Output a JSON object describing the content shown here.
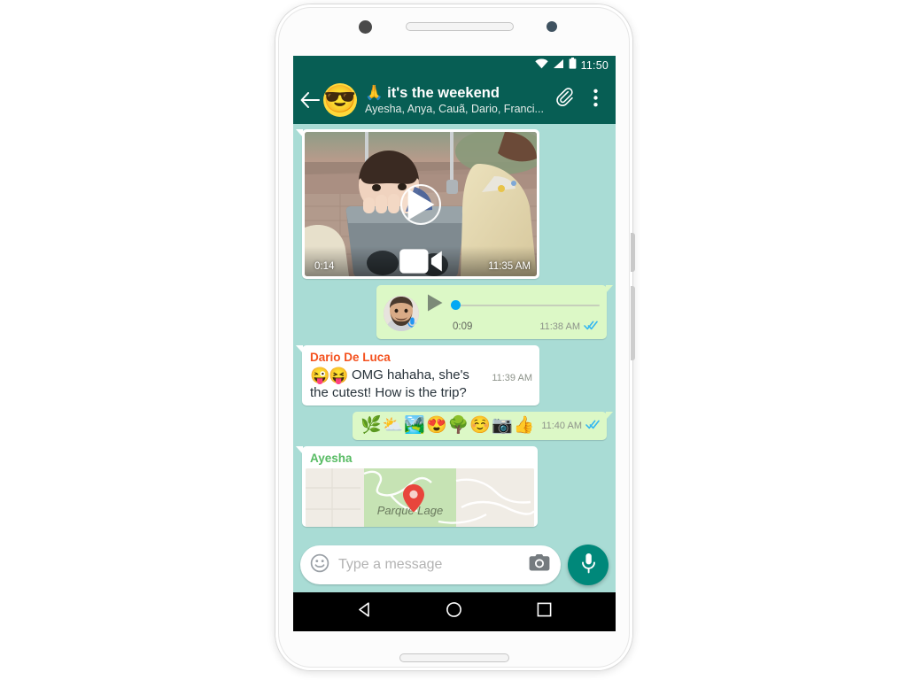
{
  "device": {
    "name": "android-phone",
    "hardware": [
      "front-camera",
      "earpiece-speaker",
      "proximity-sensor",
      "power-button",
      "volume-rocker",
      "bottom-speaker"
    ]
  },
  "status_bar": {
    "time": "11:50",
    "icons": [
      "wifi-icon",
      "signal-icon",
      "battery-icon"
    ]
  },
  "header": {
    "back_icon": "back-arrow-icon",
    "avatar_emoji": "😎",
    "title_emoji": "🙏",
    "title": "it's the weekend",
    "subtitle": "Ayesha, Anya, Cauã, Dario, Franci...",
    "attach_icon": "paperclip-icon",
    "menu_icon": "overflow-menu-icon",
    "bar_color": "#075e54"
  },
  "chat": {
    "background_color": "#a9dcd5",
    "incoming_bubble_color": "#ffffff",
    "outgoing_bubble_color": "#dcf8c6",
    "messages": [
      {
        "type": "video",
        "direction": "incoming",
        "duration": "0:14",
        "time": "11:35 AM",
        "play_icon": "play-icon",
        "video_icon": "video-camera-icon"
      },
      {
        "type": "voice",
        "direction": "outgoing",
        "duration": "0:09",
        "time": "11:38 AM",
        "play_icon": "play-icon",
        "mic_badge_icon": "microphone-icon",
        "status_icon": "read-receipt-double-check",
        "progress_percent": 0
      },
      {
        "type": "text",
        "direction": "incoming",
        "sender": "Dario De Luca",
        "emoji": "😜😝",
        "text": "OMG hahaha, she's the cutest! How is the trip?",
        "time": "11:39 AM"
      },
      {
        "type": "emoji",
        "direction": "outgoing",
        "emojis": [
          "🌿",
          "⛅",
          "🏞️",
          "😍",
          "🌳",
          "☺️",
          "📷",
          "👍"
        ],
        "time": "11:40 AM",
        "status_icon": "read-receipt-double-check"
      },
      {
        "type": "location",
        "direction": "incoming",
        "sender": "Ayesha",
        "place_label": "Parque Lage",
        "pin_icon": "map-pin-icon"
      }
    ]
  },
  "input_bar": {
    "emoji_icon": "emoji-smiley-icon",
    "placeholder": "Type a message",
    "camera_icon": "camera-icon",
    "mic_icon": "microphone-icon",
    "fab_color": "#00887a"
  },
  "nav_bar": {
    "back_icon": "android-back-icon",
    "home_icon": "android-home-icon",
    "recents_icon": "android-recents-icon"
  },
  "colors": {
    "brand_dark": "#075e54",
    "accent_teal": "#00887a",
    "sender_name": "#f4511e",
    "location_sender": "#57bb63",
    "read_receipt_blue": "#34b7f1"
  }
}
